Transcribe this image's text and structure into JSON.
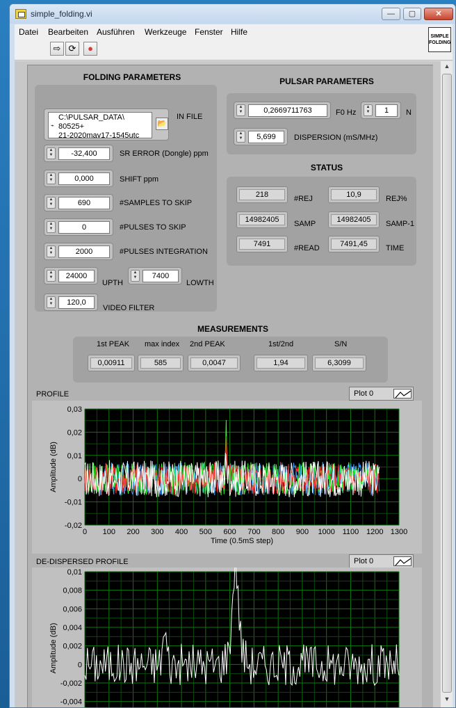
{
  "window": {
    "title": "simple_folding.vi",
    "min": "—",
    "max": "▢",
    "close": "✕"
  },
  "menu": [
    "Datei",
    "Bearbeiten",
    "Ausführen",
    "Werkzeuge",
    "Fenster",
    "Hilfe"
  ],
  "vi_icon": {
    "line1": "SIMPLE",
    "line2": "FOLDING"
  },
  "toolbar": {
    "run_icon": "run-arrow-icon",
    "run_continuous_icon": "run-continuously-icon",
    "abort_icon": "abort-stop-icon"
  },
  "folding": {
    "title": "FOLDING PARAMETERS",
    "in_file_label": "IN FILE",
    "in_file_lines": [
      "C:\\PULSAR_DATA\\",
      "80525+",
      "21-2020may17-1545utc"
    ],
    "sr_error": {
      "value": "-32,400",
      "label": "SR ERROR (Dongle) ppm"
    },
    "shift": {
      "value": "0,000",
      "label": "SHIFT ppm"
    },
    "samples_skip": {
      "value": "690",
      "label": "#SAMPLES TO SKIP"
    },
    "pulses_skip": {
      "value": "0",
      "label": "#PULSES TO SKIP"
    },
    "pulses_integration": {
      "value": "2000",
      "label": "#PULSES INTEGRATION"
    },
    "upth": {
      "value": "24000",
      "label": "UPTH"
    },
    "lowth": {
      "value": "7400",
      "label": "LOWTH"
    },
    "video_filter": {
      "value": "120,0",
      "label": "VIDEO FILTER"
    }
  },
  "pulsar": {
    "title": "PULSAR PARAMETERS",
    "f0": {
      "value": "0,2669711763",
      "label": "F0 Hz"
    },
    "n": {
      "value": "1",
      "label": "N"
    },
    "dispersion": {
      "value": "5,699",
      "label": "DISPERSION (mS/MHz)"
    }
  },
  "status": {
    "title": "STATUS",
    "rej": {
      "value": "218",
      "label": "#REJ"
    },
    "rej_pct": {
      "value": "10,9",
      "label": "REJ%"
    },
    "samp": {
      "value": "14982405",
      "label": "SAMP"
    },
    "samp1": {
      "value": "14982405",
      "label": "SAMP-1"
    },
    "read": {
      "value": "7491",
      "label": "#READ"
    },
    "time": {
      "value": "7491,45",
      "label": "TIME"
    }
  },
  "measurements": {
    "title": "MEASUREMENTS",
    "first_peak": {
      "label": "1st PEAK",
      "value": "0,00911"
    },
    "max_index": {
      "label": "max index",
      "value": "585"
    },
    "second_peak": {
      "label": "2nd PEAK",
      "value": "0,0047"
    },
    "ratio": {
      "label": "1st/2nd",
      "value": "1,94"
    },
    "sn": {
      "label": "S/N",
      "value": "6,3099"
    }
  },
  "profile": {
    "title": "PROFILE",
    "legend": "Plot 0"
  },
  "dedispersed": {
    "title": "DE-DISPERSED PROFILE",
    "legend": "Plot 0"
  },
  "chart_data": [
    {
      "type": "line",
      "title": "PROFILE",
      "xlabel": "Time (0.5mS step)",
      "ylabel": "Amplitude (dB)",
      "xlim": [
        0,
        1300
      ],
      "ylim": [
        -0.02,
        0.03
      ],
      "x_ticks": [
        "0",
        "100",
        "200",
        "300",
        "400",
        "500",
        "600",
        "700",
        "800",
        "900",
        "1000",
        "1100",
        "1200",
        "1300"
      ],
      "y_ticks": [
        "-0,02",
        "-0,01",
        "0",
        "0,01",
        "0,02",
        "0,03"
      ],
      "x_range": [
        0,
        1220
      ],
      "peak": {
        "x": 585,
        "y": 0.024
      },
      "noise_amplitude": 0.008,
      "series": [
        {
          "color": "#ffffff"
        },
        {
          "color": "#ff3030"
        },
        {
          "color": "#30ff30"
        },
        {
          "color": "#3aa0ff"
        }
      ],
      "grid": true
    },
    {
      "type": "line",
      "title": "DE-DISPERSED PROFILE",
      "ylabel": "Amplitude (dB)",
      "ylim": [
        -0.005,
        0.01
      ],
      "y_ticks": [
        "-0,004",
        "-0,002",
        "0",
        "0,002",
        "0,004",
        "0,006",
        "0,008",
        "0,01"
      ],
      "peak": {
        "x": 585,
        "y": 0.0091
      },
      "second_peak": {
        "x": 310,
        "y": 0.0047
      },
      "series": [
        {
          "color": "#ffffff"
        }
      ],
      "grid": true
    }
  ]
}
